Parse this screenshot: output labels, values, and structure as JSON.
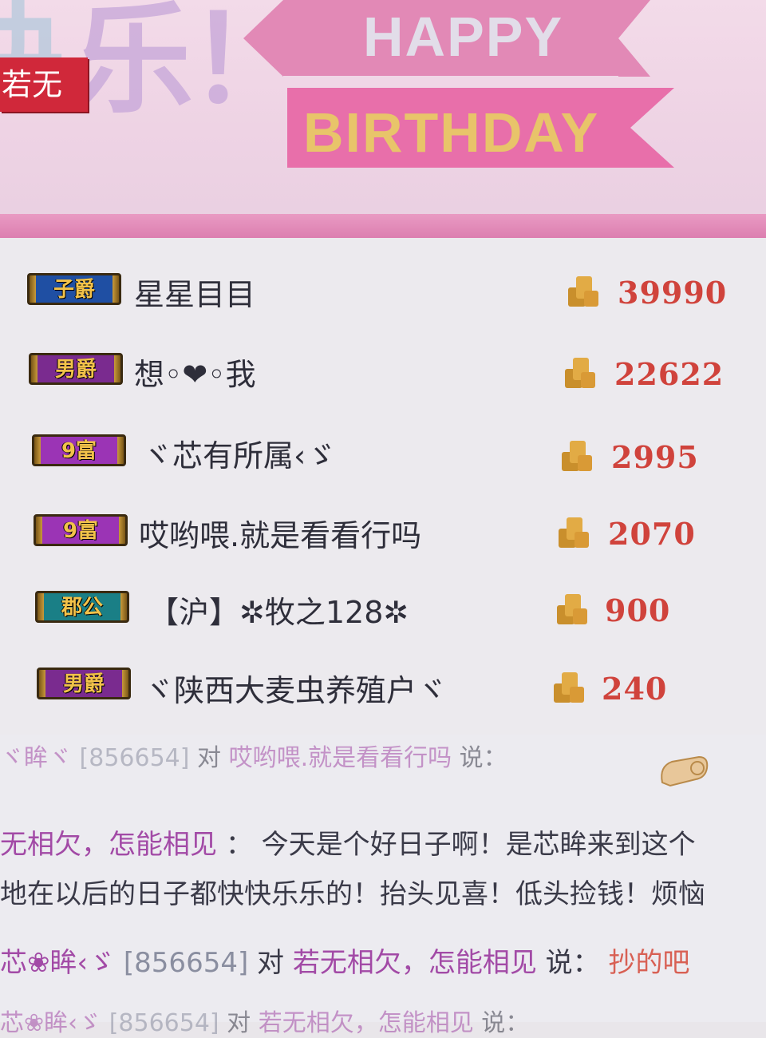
{
  "banner": {
    "tag": "若无",
    "big_char": "乐",
    "big_char_left": "快",
    "exclaim": "！",
    "happy": "HAPPY",
    "birthday": "BIRTHDAY"
  },
  "ranking": [
    {
      "badge": "子爵",
      "badge_color": "#1f4fa3",
      "name": "星星目目",
      "coins": "39990"
    },
    {
      "badge": "男爵",
      "badge_color": "#7a2b8f",
      "name": "想︎◦︎❤︎◦︎我",
      "coins": "22622"
    },
    {
      "badge": "9富",
      "badge_color": "#9b34b5",
      "name": "ヾ芯有所属‹ゞ",
      "coins": "2995"
    },
    {
      "badge": "9富",
      "badge_color": "#9b34b5",
      "name": "哎哟喂.就是看看行吗",
      "coins": "2070"
    },
    {
      "badge": "郡公",
      "badge_color": "#1a7f86",
      "name": "【沪】✲牧之128✲",
      "coins": "900"
    },
    {
      "badge": "男爵",
      "badge_color": "#7a2b8f",
      "name": "ヾ陕西大麦虫养殖户ヾ",
      "coins": "240"
    }
  ],
  "chat": {
    "line0": {
      "sender": "ヾ眸ヾ",
      "id": "[856654]",
      "to_word": "对",
      "target": "哎哟喂.就是看看行吗",
      "say": "说："
    },
    "line1": {
      "speaker": "无相欠，怎能相见",
      "sep": "：",
      "text": "今天是个好日子啊！是芯眸来到这个"
    },
    "line2": {
      "text": "地在以后的日子都快快乐乐的！抬头见喜！低头捡钱！烦恼"
    },
    "line3": {
      "sender": "芯❀眸‹ゞ",
      "id": "[856654]",
      "to_word": "对",
      "target": "若无相欠，怎能相见",
      "say": "说：",
      "text": "抄的吧"
    },
    "line4": {
      "sender": "芯❀眸‹ゞ",
      "id": "[856654]",
      "to_word": "对",
      "target": "若无相欠，怎能相见",
      "say": "说："
    }
  },
  "colors": {
    "coin_text": "#d0433c",
    "badge_gold": "#f2c24a",
    "banner_pink": "#e86faa"
  }
}
